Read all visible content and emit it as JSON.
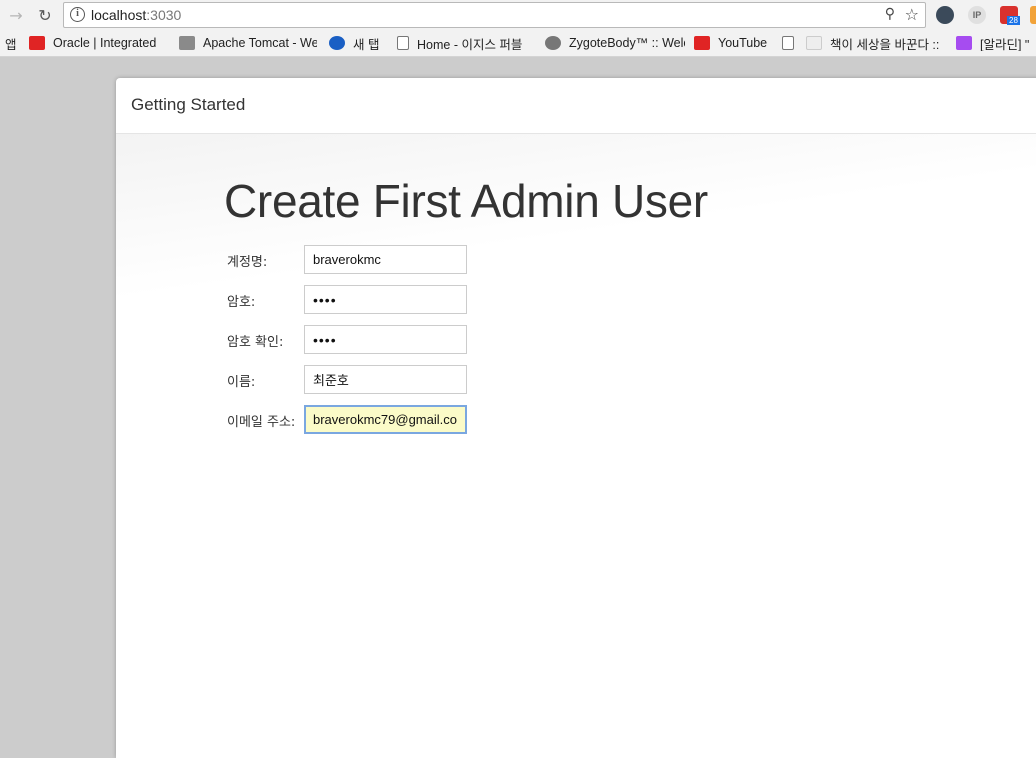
{
  "browser": {
    "url_host": "localhost",
    "url_port": ":3030",
    "ip_ext_label": "IP",
    "badge_count": "28"
  },
  "bookmarks": {
    "apps_label": "앱",
    "items": [
      {
        "label": "Oracle | Integrated C",
        "icon": "oracle-icon",
        "color": "#e02424"
      },
      {
        "label": "Apache Tomcat - We",
        "icon": "tomcat-icon",
        "color": "#8a8a8a"
      },
      {
        "label": "새 탭",
        "icon": "search-icon",
        "color": "#1a5fc4"
      },
      {
        "label": "Home - 이지스 퍼블",
        "icon": "page-icon",
        "color": "#ffffff"
      },
      {
        "label": "ZygoteBody™ :: Welc",
        "icon": "zygote-icon",
        "color": "#777777"
      },
      {
        "label": "YouTube",
        "icon": "youtube-icon",
        "color": "#e02424"
      },
      {
        "label": "",
        "icon": "page-icon",
        "color": "#ffffff"
      },
      {
        "label": "책이 세상을 바꾼다 ::",
        "icon": "book-icon",
        "color": "#eeeeee"
      },
      {
        "label": "[알라딘] \"",
        "icon": "aladin-icon",
        "color": "#a64cf0"
      }
    ]
  },
  "dialog": {
    "title": "Getting Started",
    "heading": "Create First Admin User"
  },
  "form": {
    "fields": [
      {
        "label": "계정명:",
        "value": "braverokmc",
        "type": "text"
      },
      {
        "label": "암호:",
        "value": "••••",
        "type": "password"
      },
      {
        "label": "암호 확인:",
        "value": "••••",
        "type": "password"
      },
      {
        "label": "이름:",
        "value": "최준호",
        "type": "text"
      },
      {
        "label": "이메일 주소:",
        "value": "braverokmc79@gmail.co",
        "type": "email"
      }
    ]
  }
}
